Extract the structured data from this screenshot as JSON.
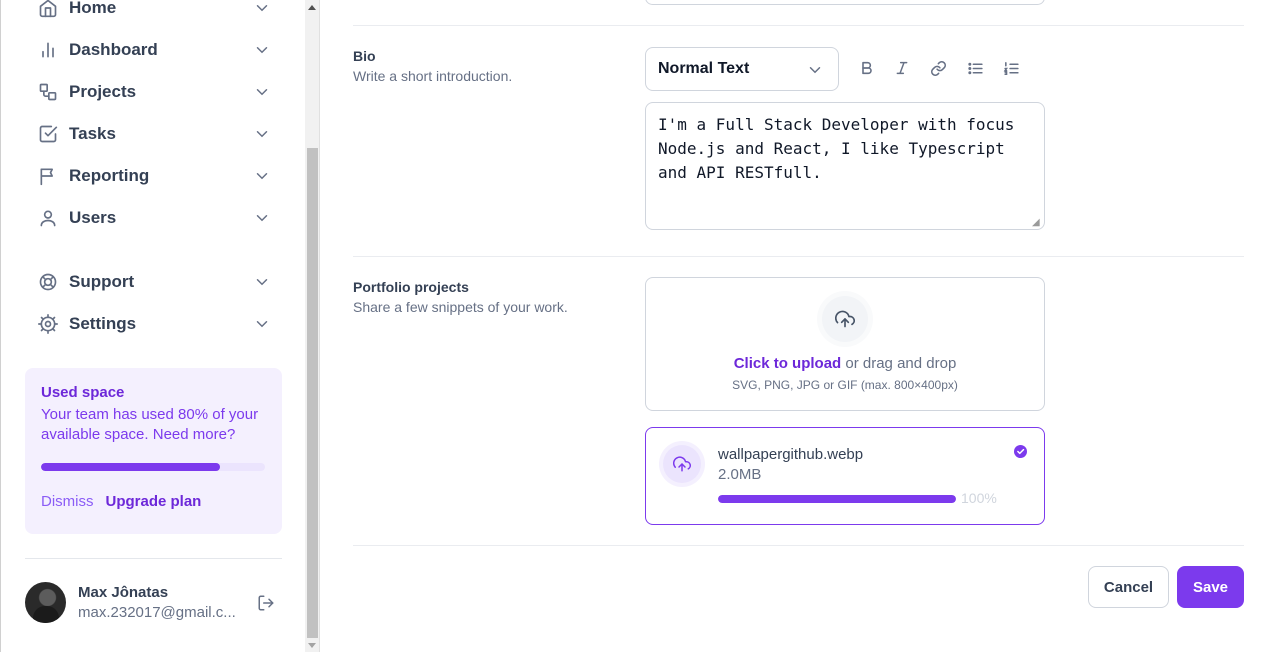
{
  "sidebar": {
    "items": [
      {
        "label": "Home",
        "icon": "home-icon"
      },
      {
        "label": "Dashboard",
        "icon": "bar-chart-icon"
      },
      {
        "label": "Projects",
        "icon": "layers-icon"
      },
      {
        "label": "Tasks",
        "icon": "check-square-icon"
      },
      {
        "label": "Reporting",
        "icon": "flag-icon"
      },
      {
        "label": "Users",
        "icon": "user-icon"
      },
      {
        "label": "Support",
        "icon": "life-buoy-icon"
      },
      {
        "label": "Settings",
        "icon": "settings-icon"
      }
    ],
    "usage": {
      "title": "Used space",
      "text": "Your team has used 80% of your available space. Need more?",
      "progress": 0.8,
      "dismiss": "Dismiss",
      "upgrade": "Upgrade plan"
    },
    "profile": {
      "name": "Max Jônatas",
      "email": "max.232017@gmail.c..."
    }
  },
  "bio": {
    "title": "Bio",
    "subtitle": "Write a short introduction.",
    "format_select": "Normal Text",
    "text": "I'm a Full Stack Developer with focus Node.js and React, I like Typescript and API RESTfull."
  },
  "portfolio": {
    "title": "Portfolio projects",
    "subtitle": "Share a few snippets of your work.",
    "upload_link": "Click to upload",
    "upload_rest": "or drag and drop",
    "upload_hint": "SVG, PNG, JPG or GIF (max. 800×400px)",
    "file": {
      "name": "wallpapergithub.webp",
      "size": "2.0MB",
      "progress_label": "100%",
      "progress": 1.0
    }
  },
  "actions": {
    "cancel": "Cancel",
    "save": "Save"
  },
  "colors": {
    "accent": "#7c3aed",
    "accent_light": "#f4f0fe"
  }
}
